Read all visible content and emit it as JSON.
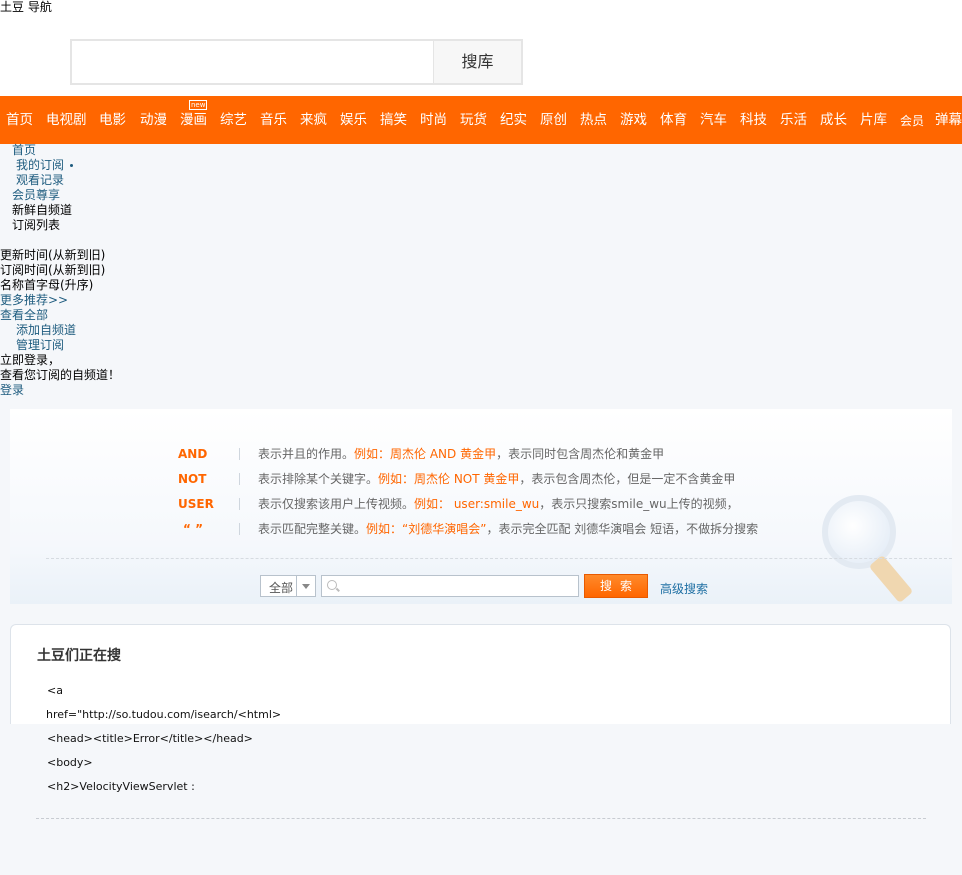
{
  "page_title": "土豆 导航",
  "search": {
    "placeholder": "",
    "button_label": "搜库"
  },
  "nav": {
    "items": [
      {
        "label": "首页"
      },
      {
        "label": "电视剧"
      },
      {
        "label": "电影"
      },
      {
        "label": "动漫"
      },
      {
        "label": "漫画",
        "badge": "new"
      },
      {
        "label": "综艺"
      },
      {
        "label": "音乐"
      },
      {
        "label": "来疯"
      },
      {
        "label": "娱乐"
      },
      {
        "label": "搞笑"
      },
      {
        "label": "时尚"
      },
      {
        "label": "玩货"
      },
      {
        "label": "纪实"
      },
      {
        "label": "原创"
      },
      {
        "label": "热点"
      },
      {
        "label": "游戏"
      },
      {
        "label": "体育"
      },
      {
        "label": "汽车"
      },
      {
        "label": "科技"
      },
      {
        "label": "乐活"
      },
      {
        "label": "成长"
      },
      {
        "label": "片库"
      },
      {
        "label": "会员"
      },
      {
        "label": "弹幕"
      }
    ]
  },
  "links": {
    "home": "首页",
    "my_subscriptions": "我的订阅",
    "watch_history": "观看记录",
    "member_privilege": "会员尊享",
    "fresh_channels": "新鲜自频道",
    "subscription_list": "订阅列表",
    "sort_updated": "更新时间(从新到旧)",
    "sort_subscribed": "订阅时间(从新到旧)",
    "sort_name": "名称首字母(升序)",
    "more_recommend": "更多推荐>>",
    "view_all": "查看全部",
    "add_channel": "添加自频道",
    "manage_subscriptions": "管理订阅",
    "login_now": "立即登录，",
    "view_your_channels": "查看您订阅的自频道！",
    "login": "登录"
  },
  "tips": [
    {
      "key": "AND",
      "desc1": "表示并且的作用。",
      "example": "例如：周杰伦 AND 黄金甲",
      "desc2": "，表示同时包含周杰伦和黄金甲"
    },
    {
      "key": "NOT",
      "desc1": "表示排除某个关键字。",
      "example": "例如：周杰伦 NOT 黄金甲",
      "desc2": "，表示包含周杰伦，但是一定不含黄金甲"
    },
    {
      "key": "USER",
      "desc1": "表示仅搜索该用户上传视频。",
      "example": "例如： user:smile_wu",
      "desc2": "，表示只搜索smile_wu上传的视频，"
    },
    {
      "key": "“ ”",
      "desc1": "表示匹配完整关键。",
      "example": "例如：“刘德华演唱会”",
      "desc2": "，表示完全匹配 刘德华演唱会 短语，不做拆分搜索"
    }
  ],
  "advanced_search": {
    "scope_label": "全部",
    "placeholder": "",
    "button_label": "搜索",
    "link_label": "高级搜索"
  },
  "hot": {
    "title": "土豆们正在搜",
    "code_lines": [
      "<a",
      "href=\"http://so.tudou.com/isearch/<html>",
      "<head><title>Error</title></head>",
      "<body>",
      "<h2>VelocityViewServlet :"
    ]
  }
}
